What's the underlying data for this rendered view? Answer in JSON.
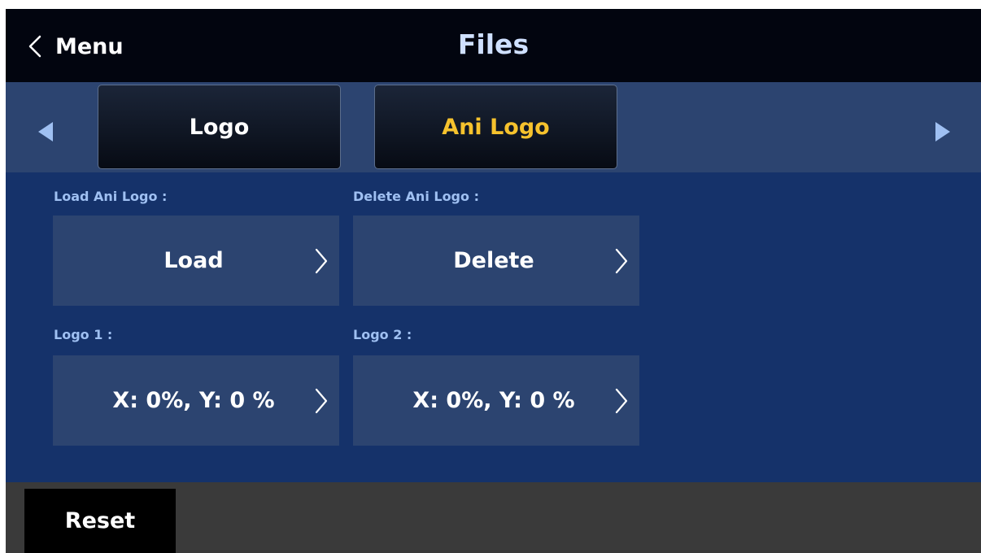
{
  "header": {
    "back_label": "Menu",
    "title": "Files"
  },
  "tabs": [
    {
      "label": "Logo",
      "active": false
    },
    {
      "label": "Ani Logo",
      "active": true,
      "color": "#f6c22d"
    }
  ],
  "fields": {
    "load": {
      "label": "Load Ani Logo :",
      "value": "Load"
    },
    "delete": {
      "label": "Delete Ani Logo :",
      "value": "Delete"
    },
    "logo1": {
      "label": "Logo 1 :",
      "value": "X: 0%, Y: 0 %"
    },
    "logo2": {
      "label": "Logo 2 :",
      "value": "X: 0%, Y: 0 %"
    }
  },
  "footer": {
    "reset_label": "Reset"
  },
  "icons": {
    "back": "chevron-left-icon",
    "prev": "triangle-left-icon",
    "next": "triangle-right-icon",
    "field_arrow": "chevron-right-icon"
  },
  "colors": {
    "header_bg": "#02050f",
    "content_bg": "#15326a",
    "panel_bg": "#2c4470",
    "active_tab_text": "#f6c22d",
    "field_label": "#9fc0f2",
    "title_text": "#cfe0ff",
    "footer_bg": "#3a3a3a"
  }
}
